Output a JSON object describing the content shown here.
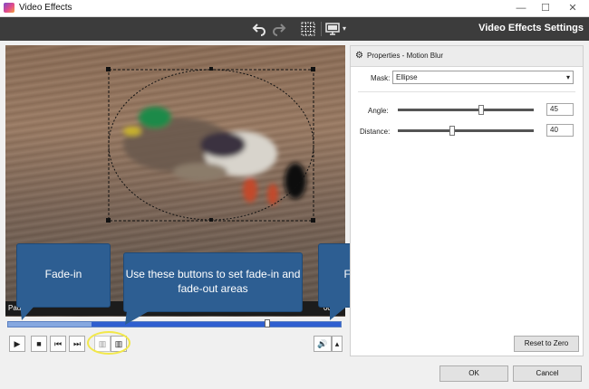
{
  "window": {
    "title": "Video Effects",
    "min_glyph": "—",
    "max_glyph": "☐",
    "close_glyph": "✕"
  },
  "toolbar": {
    "title": "Video Effects Settings",
    "icons": [
      "undo-icon",
      "redo-icon",
      "grid-icon",
      "monitor-icon"
    ]
  },
  "preview": {
    "status_left": "Paus",
    "status_right": "00:04"
  },
  "timeline": {
    "fade_in_fraction": 0.25,
    "playhead_fraction": 0.78
  },
  "playback": {
    "play_glyph": "▶",
    "stop_glyph": "■",
    "prev_glyph": "⏮",
    "next_glyph": "⏭",
    "fade_in_glyph": "▥",
    "fade_out_glyph": "▥",
    "volume_glyph": "🔊",
    "menu_glyph": "▴"
  },
  "callouts": {
    "fade_in": "Fade-in",
    "middle": "Use these buttons to set fade-in and fade-out areas",
    "fade_out": "Fade-out"
  },
  "properties": {
    "header": "Properties - Motion Blur",
    "mask_label": "Mask:",
    "mask_value": "Ellipse",
    "angle_label": "Angle:",
    "angle_value": "45",
    "angle_fraction": 0.61,
    "distance_label": "Distance:",
    "distance_value": "40",
    "distance_fraction": 0.4,
    "reset_label": "Reset to Zero"
  },
  "dialog": {
    "ok_label": "OK",
    "cancel_label": "Cancel"
  },
  "colors": {
    "callout": "#2d5e92",
    "toolbar": "#3c3c3c",
    "timeline": "#86a8e0",
    "highlight": "#f2e84a"
  }
}
